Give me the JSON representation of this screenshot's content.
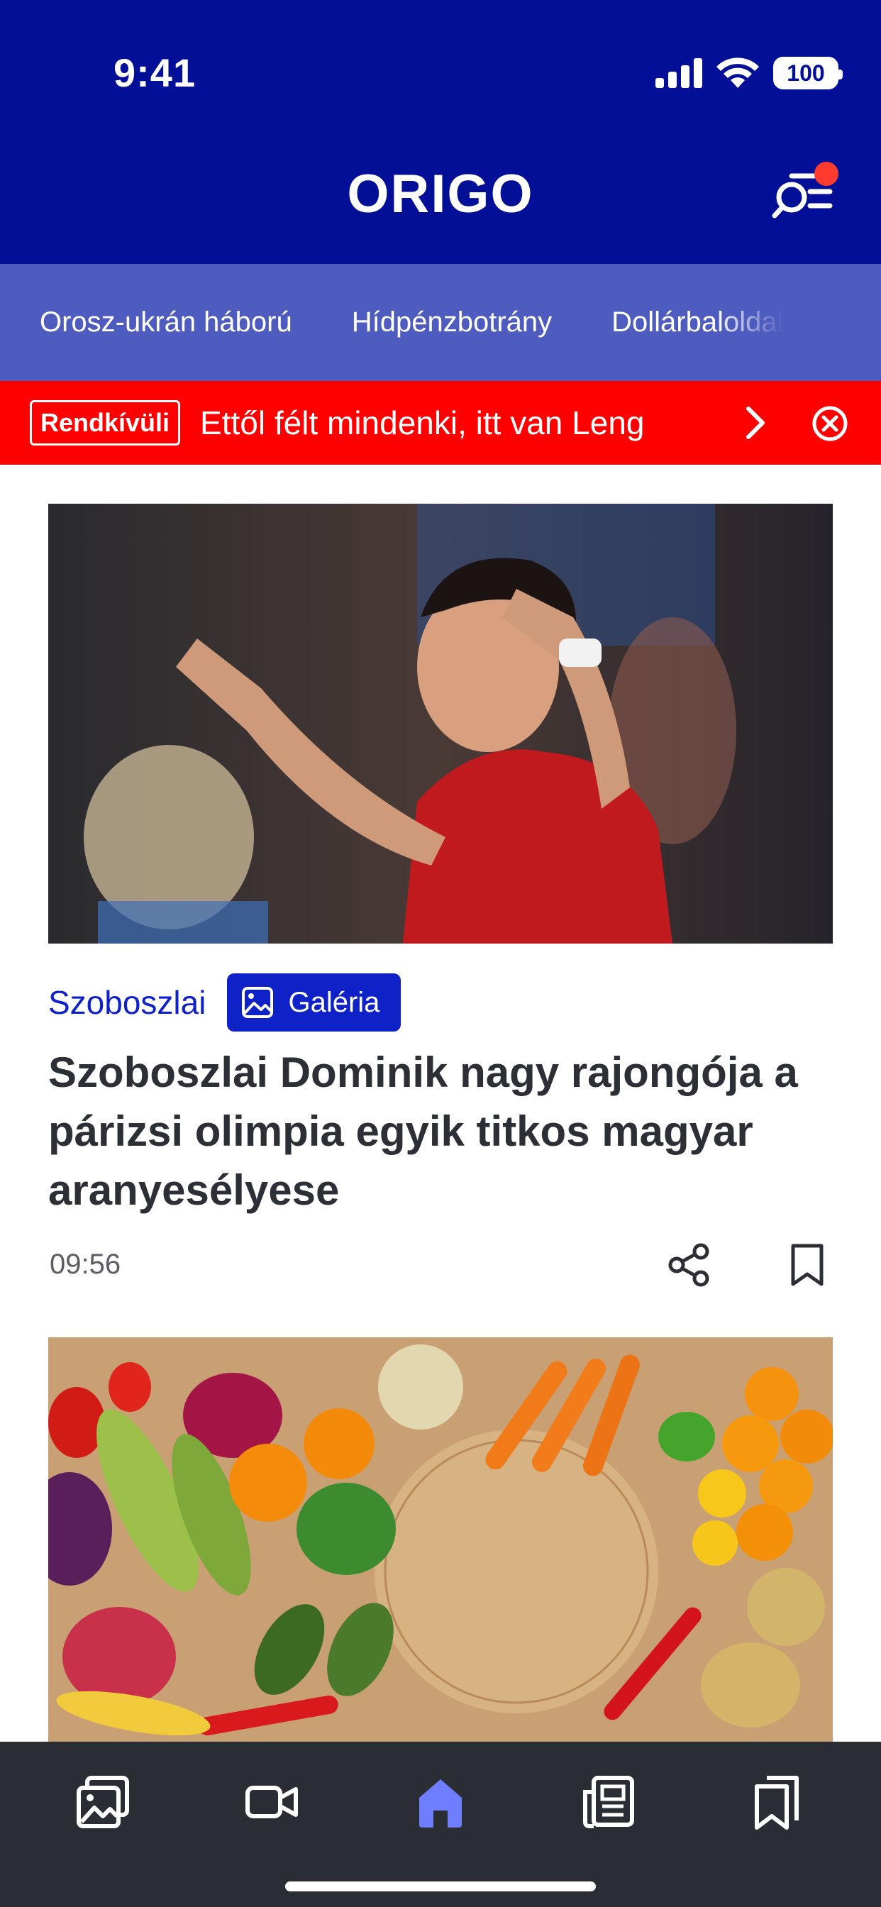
{
  "status_bar": {
    "time": "9:41",
    "battery": "100"
  },
  "header": {
    "logo": "ORIGO"
  },
  "topics": [
    "Orosz-ukrán háború",
    "Hídpénzbotrány",
    "Dollárbaloldal"
  ],
  "breaking": {
    "badge": "Rendkívüli",
    "headline": "Ettől félt mindenki, itt van Leng"
  },
  "article1": {
    "category": "Szoboszlai",
    "gallery_label": "Galéria",
    "title": "Szoboszlai Dominik nagy rajongója a párizsi olimpia egyik titkos magyar aranyesélyese",
    "time": "09:56"
  },
  "colors": {
    "header_bg": "#020f96",
    "topics_bg": "#4e5bbf",
    "breaking_bg": "#ff0000",
    "accent": "#0e22c8",
    "tabbar_bg": "#2b2d34",
    "active_tab": "#6f7dff"
  },
  "tabbar": {
    "items": [
      "gallery-icon",
      "video-icon",
      "home-icon",
      "newspaper-icon",
      "bookmarks-icon"
    ],
    "active": "home-icon"
  }
}
